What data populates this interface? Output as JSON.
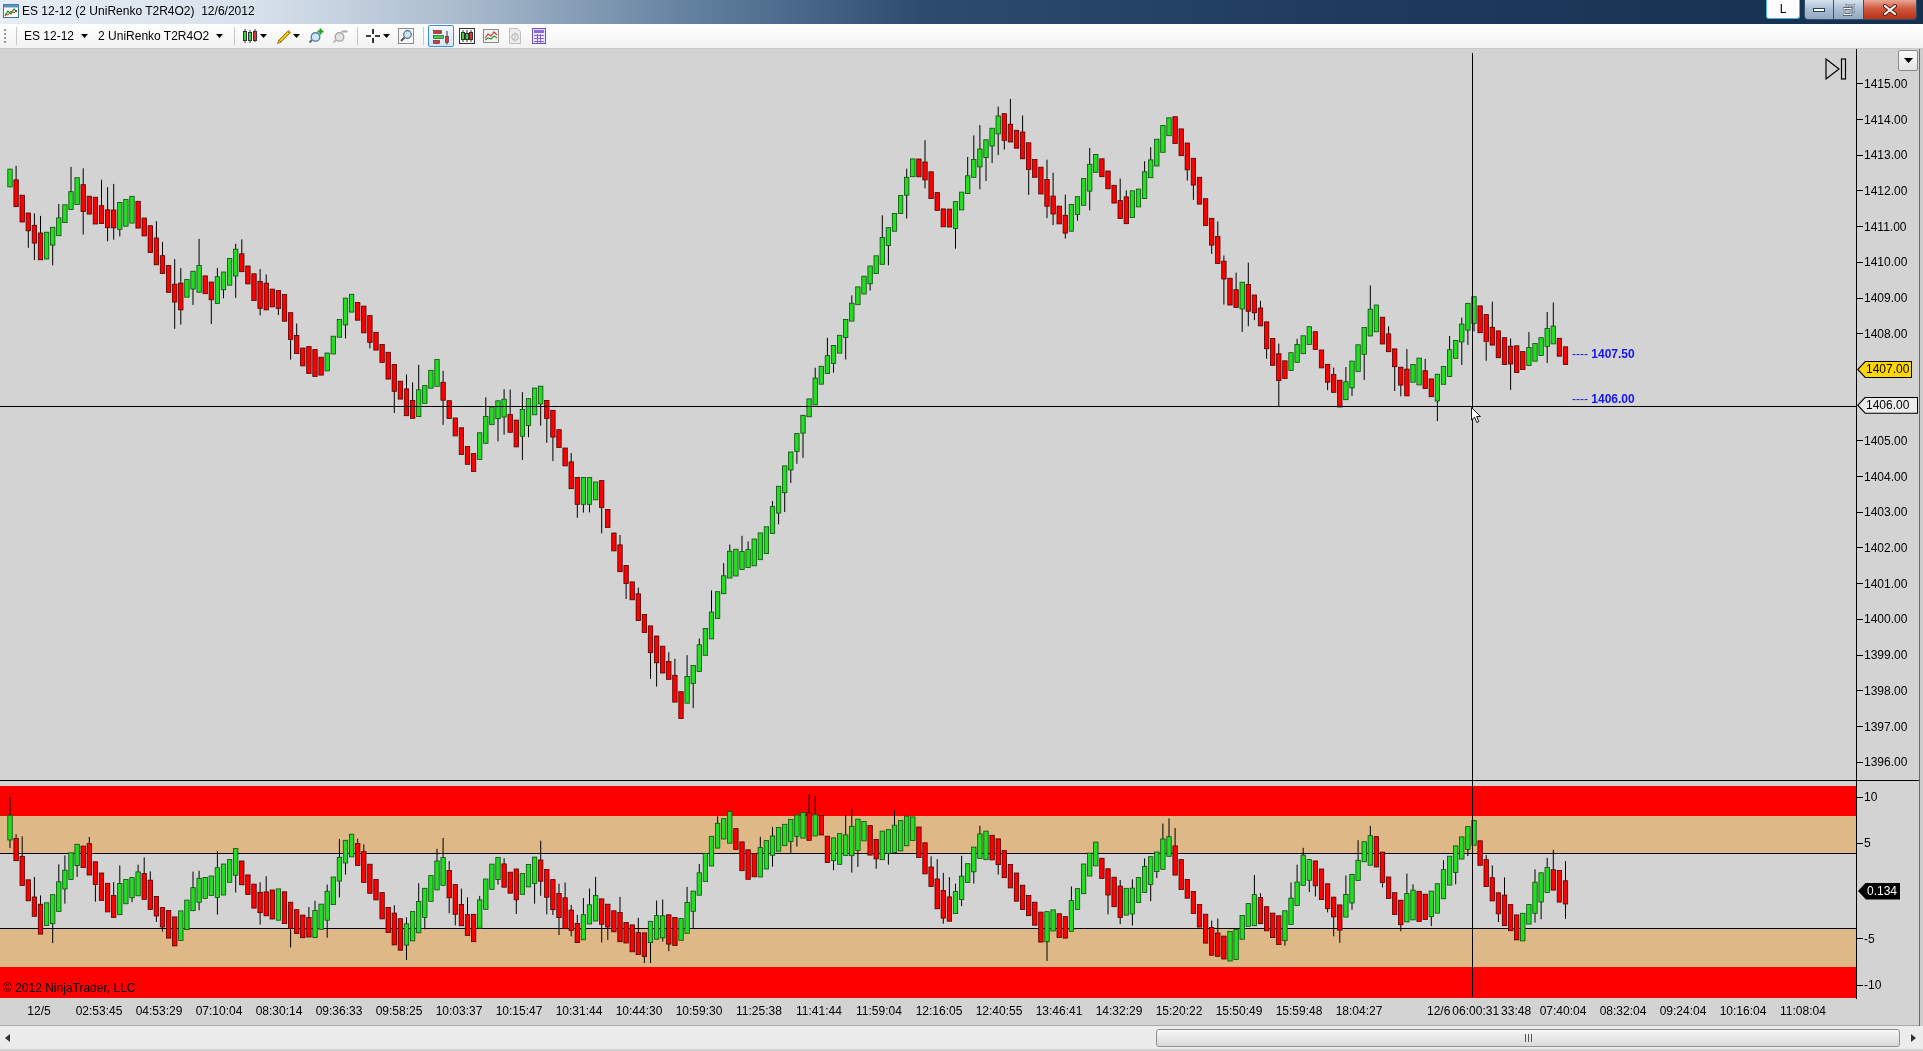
{
  "window": {
    "title": "ES 12-12 (2 UniRenko T2R4O2)  12/6/2012",
    "caption_button": "L"
  },
  "toolbar": {
    "instrument": "ES 12-12",
    "bar_type": "2 UniRenko T2R4O2",
    "tool_groups": [
      [
        {
          "kind": "candlesticks",
          "dropdown": true,
          "disabled": false,
          "selected": false
        },
        {
          "kind": "pencil",
          "dropdown": true,
          "disabled": false,
          "selected": false
        },
        {
          "kind": "magnifier-plus",
          "dropdown": false,
          "disabled": false,
          "selected": false
        },
        {
          "kind": "magnifier-minus",
          "dropdown": false,
          "disabled": true,
          "selected": false
        }
      ],
      [
        {
          "kind": "crosshair",
          "dropdown": true,
          "disabled": false,
          "selected": false
        },
        {
          "kind": "magnifier",
          "dropdown": false,
          "disabled": false,
          "selected": false
        }
      ],
      [
        {
          "kind": "order-bars",
          "dropdown": false,
          "disabled": false,
          "selected": true
        },
        {
          "kind": "framed-candlesticks",
          "dropdown": false,
          "disabled": false,
          "selected": false
        },
        {
          "kind": "line-chart",
          "dropdown": false,
          "disabled": false,
          "selected": false
        },
        {
          "kind": "document",
          "dropdown": false,
          "disabled": true,
          "selected": false
        },
        {
          "kind": "table",
          "dropdown": false,
          "disabled": false,
          "selected": false
        }
      ]
    ]
  },
  "price_panel": {
    "y_axis": {
      "ticks_above": [
        "1415.00",
        "1414.00",
        "1413.00",
        "1412.00",
        "1411.00",
        "1410.00",
        "1409.00",
        "1408.00"
      ],
      "last_price": "1407.00",
      "crosshair_price": "1406.00",
      "ticks_below": [
        "1405.00",
        "1404.00",
        "1403.00",
        "1402.00",
        "1401.00",
        "1400.00",
        "1399.00",
        "1398.00",
        "1397.00",
        "1396.00"
      ]
    },
    "price_levels": [
      "---- **1407.50**",
      "---- **1406.00**"
    ]
  },
  "oscillator_panel": {
    "y_axis": {
      "ticks_above": [
        "10",
        "5"
      ],
      "current_value": "0.134",
      "ticks_below": [
        "-5",
        "-10"
      ]
    },
    "copyright": "© 2012 NinjaTrader, LLC"
  },
  "x_axis": {
    "labels": [
      "12/5",
      "02:53:45",
      "04:53:29",
      "07:10:04",
      "08:30:14",
      "09:36:33",
      "09:58:25",
      "10:03:37",
      "10:15:47",
      "10:31:44",
      "10:44:30",
      "10:59:30",
      "11:25:38",
      "11:41:44",
      "11:59:04",
      "12:16:05",
      "12:40:55",
      "13:46:41",
      "14:32:29",
      "15:20:22",
      "15:50:49",
      "15:59:48",
      "18:04:27"
    ],
    "session_labels": [
      "12/6",
      "06:00:31",
      "33:48"
    ],
    "labels_after": [
      "07:40:04",
      "08:32:04",
      "09:24:04",
      "10:16:04",
      "11:08:04"
    ]
  }
}
